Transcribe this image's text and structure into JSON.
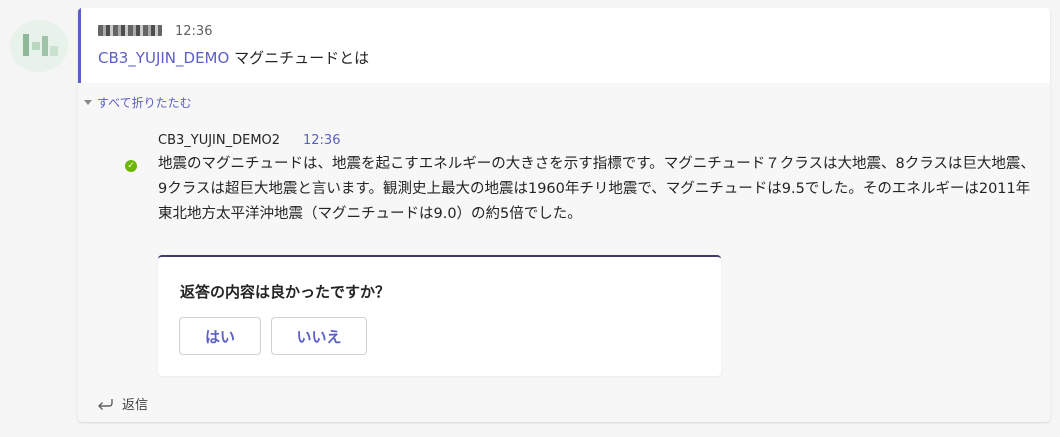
{
  "parent_message": {
    "time": "12:36",
    "mention": "CB3_YUJIN_DEMO",
    "text": "マグニチュードとは"
  },
  "thread": {
    "collapse_label": "すべて折りたたむ"
  },
  "reply": {
    "author": "CB3_YUJIN_DEMO2",
    "time": "12:36",
    "text": "地震のマグニチュードは、地震を起こすエネルギーの大きさを示す指標です。マグニチュード７クラスは大地震、8クラスは巨大地震、9クラスは超巨大地震と言います。観測史上最大の地震は1960年チリ地震で、マグニチュードは9.5でした。そのエネルギーは2011年東北地方太平洋沖地震（マグニチュードは9.0）の約5倍でした。"
  },
  "feedback_card": {
    "question": "返答の内容は良かったですか？",
    "yes_label": "はい",
    "no_label": "いいえ"
  },
  "footer": {
    "reply_label": "返信"
  },
  "colors": {
    "accent": "#5b5fc7",
    "status_ok": "#6bb700"
  }
}
